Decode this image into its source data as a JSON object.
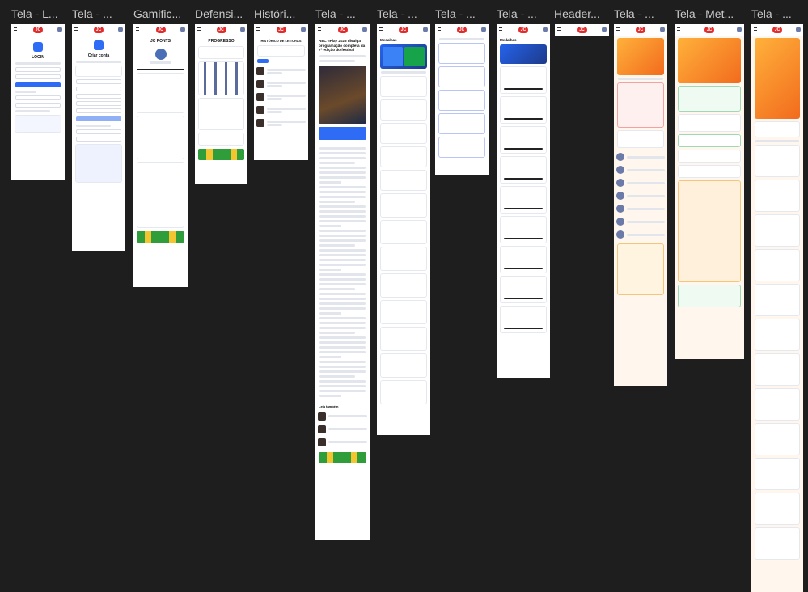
{
  "canvas": {
    "background": "#1e1e1e"
  },
  "frames": [
    {
      "title": "Tela - L..."
    },
    {
      "title": "Tela - ..."
    },
    {
      "title": "Gamific..."
    },
    {
      "title": "Defensi..."
    },
    {
      "title": "Históri..."
    },
    {
      "title": "Tela - ..."
    },
    {
      "title": "Tela - ..."
    },
    {
      "title": "Tela - ..."
    },
    {
      "title": "Tela - ..."
    },
    {
      "title": "Header..."
    },
    {
      "title": "Tela - ..."
    },
    {
      "title": "Tela - Met..."
    },
    {
      "title": "Tela - ..."
    }
  ],
  "screens": {
    "login": {
      "title": "LOGIN",
      "button": "Entrar"
    },
    "signup": {
      "title": "Criar conta",
      "button": "Criar conta"
    },
    "gamification": {
      "title": "JC PONTS",
      "user": "Fernando Azevedo"
    },
    "progress": {
      "title": "PROGRESSO"
    },
    "history": {
      "title": "HISTÓRICO DE LEITURAS"
    },
    "article": {
      "headline": "REC'nPlay 2025 divulga programação completa da 7ª edição do festival",
      "more": "Leia também"
    },
    "medals_1": {
      "title": "Medalhas"
    },
    "medals_2": {
      "title": "Medalhas"
    },
    "metas": {
      "title": "Metas diárias"
    }
  },
  "colors": {
    "accent_blue": "#2f6cf6",
    "brand_red": "#e32b2b",
    "orange": "#f26b1d"
  }
}
